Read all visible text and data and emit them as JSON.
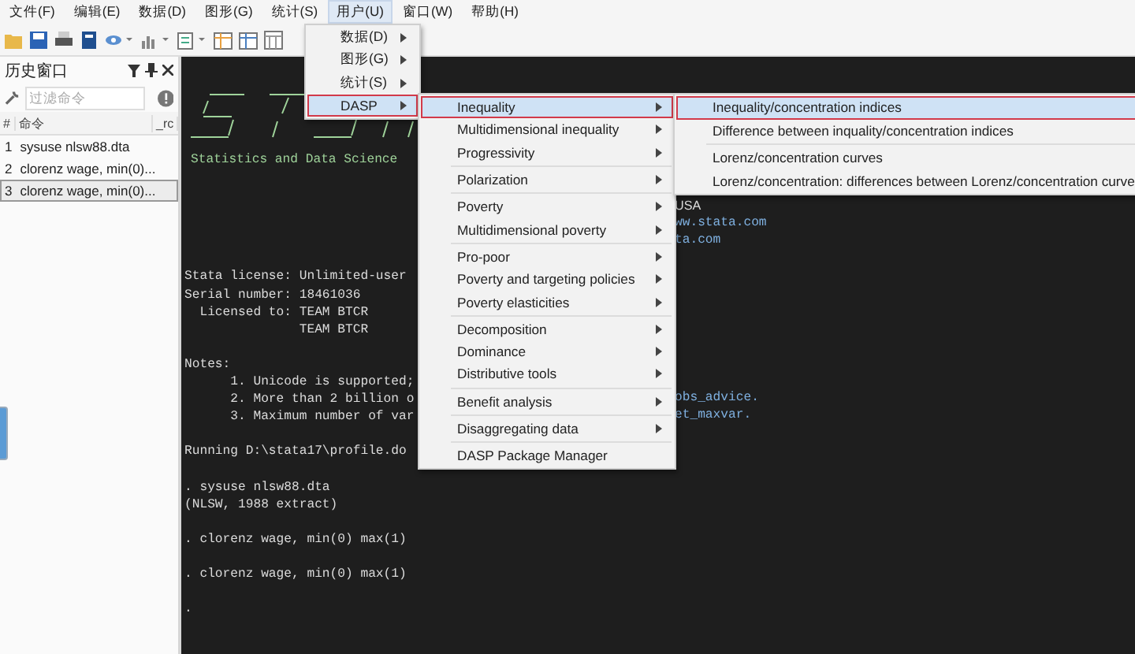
{
  "menu_bar": [
    {
      "label": "文件(F)",
      "selected": false
    },
    {
      "label": "编辑(E)",
      "selected": false
    },
    {
      "label": "数据(D)",
      "selected": false
    },
    {
      "label": "图形(G)",
      "selected": false
    },
    {
      "label": "统计(S)",
      "selected": false
    },
    {
      "label": "用户(U)",
      "selected": true
    },
    {
      "label": "窗口(W)",
      "selected": false
    },
    {
      "label": "帮助(H)",
      "selected": false
    }
  ],
  "history": {
    "title": "历史窗口",
    "filter": {
      "placeholder": "过滤命令"
    },
    "columns": [
      "#",
      "命令",
      "_rc"
    ],
    "rows": [
      {
        "number": "1",
        "command": "sysuse nlsw88.dta",
        "selected": false
      },
      {
        "number": "2",
        "command": "clorenz wage, min(0)...",
        "selected": false
      },
      {
        "number": "3",
        "command": "clorenz wage, min(0)...",
        "selected": true
      }
    ]
  },
  "console": {
    "subtitle": "Statistics and Data Science",
    "lines": [
      {
        "kind": "text",
        "tail": {
          "text": "USA",
          "link": false
        }
      },
      {
        "kind": "text",
        "tail": {
          "text": "ww.stata.com",
          "link": true
        }
      },
      {
        "kind": "text",
        "tail": {
          "text": "ta.com",
          "link": true
        }
      },
      {
        "kind": "blank"
      },
      {
        "kind": "text",
        "text": "Stata license: Unlimited-user"
      },
      {
        "kind": "text",
        "text": "Serial number: 18461036"
      },
      {
        "kind": "text",
        "text": "  Licensed to: TEAM BTCR"
      },
      {
        "kind": "text",
        "text": "               TEAM BTCR"
      },
      {
        "kind": "blank"
      },
      {
        "kind": "text",
        "text": "Notes:"
      },
      {
        "kind": "text",
        "text": "      1. Unicode is supported;"
      },
      {
        "kind": "text",
        "text": "      2. More than 2 billion o",
        "tail": {
          "text": "obs_advice.",
          "link": true
        }
      },
      {
        "kind": "text",
        "text": "      3. Maximum number of var",
        "tail": {
          "text": "et_maxvar.",
          "link": true
        }
      },
      {
        "kind": "blank"
      },
      {
        "kind": "text",
        "text": "Running D:\\stata17\\profile.do"
      },
      {
        "kind": "blank"
      },
      {
        "kind": "text",
        "text": ". sysuse nlsw88.dta"
      },
      {
        "kind": "text",
        "text": "(NLSW, 1988 extract)"
      },
      {
        "kind": "blank"
      },
      {
        "kind": "text",
        "text": ". clorenz wage, min(0) max(1)"
      },
      {
        "kind": "blank"
      },
      {
        "kind": "text",
        "text": ". clorenz wage, min(0) max(1)"
      },
      {
        "kind": "blank"
      },
      {
        "kind": "text",
        "text": "."
      }
    ]
  },
  "user_menu": [
    {
      "label": "数据(D)",
      "selected": false,
      "has_submenu": true
    },
    {
      "label": "图形(G)",
      "selected": false,
      "has_submenu": true
    },
    {
      "label": "统计(S)",
      "selected": false,
      "has_submenu": true
    },
    {
      "label": "DASP",
      "selected": true,
      "has_submenu": true
    }
  ],
  "dasp_menu": [
    [
      {
        "label": "Inequality",
        "selected": true,
        "has_submenu": true
      },
      {
        "label": "Multidimensional inequality",
        "selected": false,
        "has_submenu": true
      },
      {
        "label": "Progressivity",
        "selected": false,
        "has_submenu": true
      }
    ],
    [
      {
        "label": "Polarization",
        "selected": false,
        "has_submenu": true
      }
    ],
    [
      {
        "label": "Poverty",
        "selected": false,
        "has_submenu": true
      },
      {
        "label": "Multidimensional poverty",
        "selected": false,
        "has_submenu": true
      }
    ],
    [
      {
        "label": "Pro-poor",
        "selected": false,
        "has_submenu": true
      },
      {
        "label": "Poverty and targeting policies",
        "selected": false,
        "has_submenu": true
      },
      {
        "label": "Poverty elasticities",
        "selected": false,
        "has_submenu": true
      }
    ],
    [
      {
        "label": "Decomposition",
        "selected": false,
        "has_submenu": true
      },
      {
        "label": "Dominance",
        "selected": false,
        "has_submenu": true
      },
      {
        "label": "Distributive tools",
        "selected": false,
        "has_submenu": true
      }
    ],
    [
      {
        "label": "Benefit analysis",
        "selected": false,
        "has_submenu": true
      }
    ],
    [
      {
        "label": "Disaggregating data",
        "selected": false,
        "has_submenu": true
      }
    ],
    [
      {
        "label": "DASP Package Manager",
        "selected": false,
        "has_submenu": false
      }
    ]
  ],
  "inequality_menu": [
    [
      {
        "label": "Inequality/concentration indices",
        "selected": true
      },
      {
        "label": "Difference between inquality/concentration indices",
        "selected": false
      }
    ],
    [
      {
        "label": "Lorenz/concentration curves",
        "selected": false
      },
      {
        "label": "Lorenz/concentration: differences between Lorenz/concentration curve",
        "selected": false
      }
    ]
  ]
}
